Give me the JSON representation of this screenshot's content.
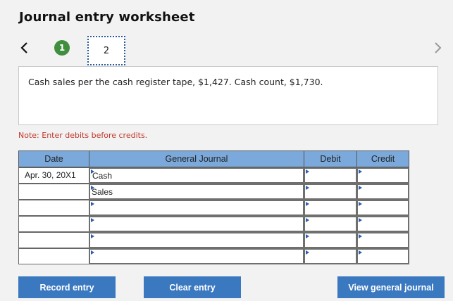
{
  "header": {
    "title": "Journal entry worksheet"
  },
  "steps": [
    {
      "label": "1"
    },
    {
      "label": "2"
    }
  ],
  "question": {
    "text": "Cash sales per the cash register tape, $1,427. Cash count, $1,730."
  },
  "note": "Note: Enter debits before credits.",
  "journal": {
    "columns": {
      "date": "Date",
      "account": "General Journal",
      "debit": "Debit",
      "credit": "Credit"
    },
    "rows": [
      {
        "date": "Apr. 30, 20X1",
        "account": "Cash",
        "debit": "",
        "credit": ""
      },
      {
        "date": "",
        "account": "Sales",
        "debit": "",
        "credit": ""
      },
      {
        "date": "",
        "account": "",
        "debit": "",
        "credit": ""
      },
      {
        "date": "",
        "account": "",
        "debit": "",
        "credit": ""
      },
      {
        "date": "",
        "account": "",
        "debit": "",
        "credit": ""
      },
      {
        "date": "",
        "account": "",
        "debit": "",
        "credit": ""
      }
    ]
  },
  "buttons": {
    "record": "Record entry",
    "clear": "Clear entry",
    "view": "View general journal"
  },
  "colors": {
    "header_bg": "#7ba9db",
    "button_bg": "#3a78c0",
    "step_done": "#3f8f3f",
    "note": "#c0392b"
  },
  "icons": {
    "prev": "chevron-left-icon",
    "next": "chevron-right-icon",
    "dropdown": "triangle-right-icon"
  }
}
